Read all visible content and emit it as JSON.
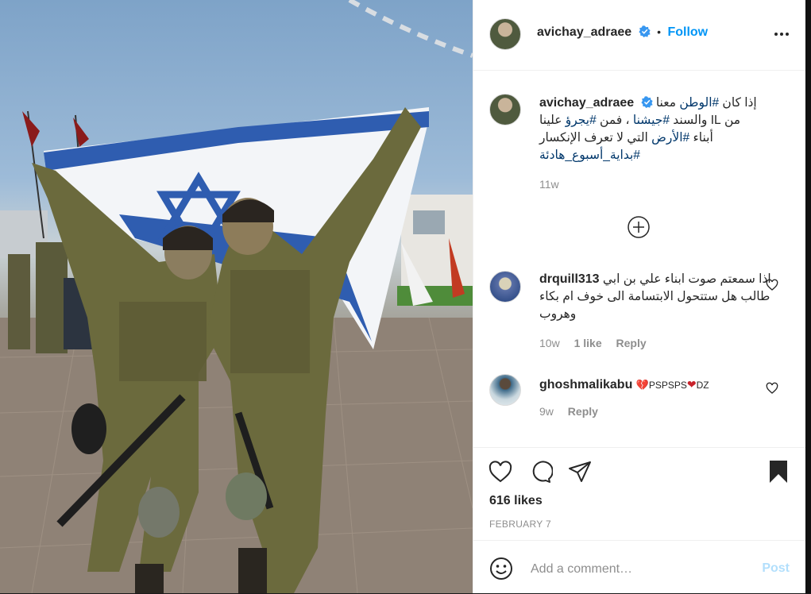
{
  "post": {
    "image_alt": "Two soldiers holding an Israeli flag",
    "author": {
      "username": "avichay_adraee",
      "verified": true,
      "follow_label": "Follow",
      "separator": "•"
    },
    "caption": {
      "username": "avichay_adraee",
      "line1_prefix": "إذا كان ",
      "line1_tag": "#الوطن",
      "line1_suffix": " معنا",
      "line2_prefix": "من IL والسند ",
      "line2_tag1": "#جيشنا",
      "line2_mid": " ، فمن ",
      "line2_tag2": "#يجرؤ",
      "line2_suffix": " علينا",
      "line3_prefix": "أبناء ",
      "line3_tag": "#الأرض",
      "line3_suffix": " التي لا تعرف الإنكسار",
      "line4_tag": "#بداية_أسبوع_هادئة",
      "time": "11w"
    },
    "comments": [
      {
        "username": "drquill313",
        "text": "اذا سمعتم صوت ابناء علي بن ابي طالب هل ستتحول الابتسامة الى خوف ام بكاء وهروب",
        "time": "10w",
        "likes": "1 like",
        "reply": "Reply"
      },
      {
        "username": "ghoshmalikabu",
        "text_a": "💔",
        "text_b": "PSPSPS",
        "text_c": "❤",
        "text_d": "DZ",
        "time": "9w",
        "reply": "Reply"
      }
    ],
    "likes": "616 likes",
    "date": "FEBRUARY 7",
    "add_comment": {
      "placeholder": "Add a comment…",
      "post_label": "Post"
    }
  },
  "colors": {
    "accent": "#0095f6",
    "hashtag": "#00376b",
    "muted": "#8e8e8e",
    "post_disabled": "#b2dffc"
  },
  "icons": [
    "verified-badge-icon",
    "more-options-icon",
    "load-more-comments-icon",
    "heart-icon",
    "comment-icon",
    "share-icon",
    "bookmark-icon",
    "emoji-icon"
  ]
}
